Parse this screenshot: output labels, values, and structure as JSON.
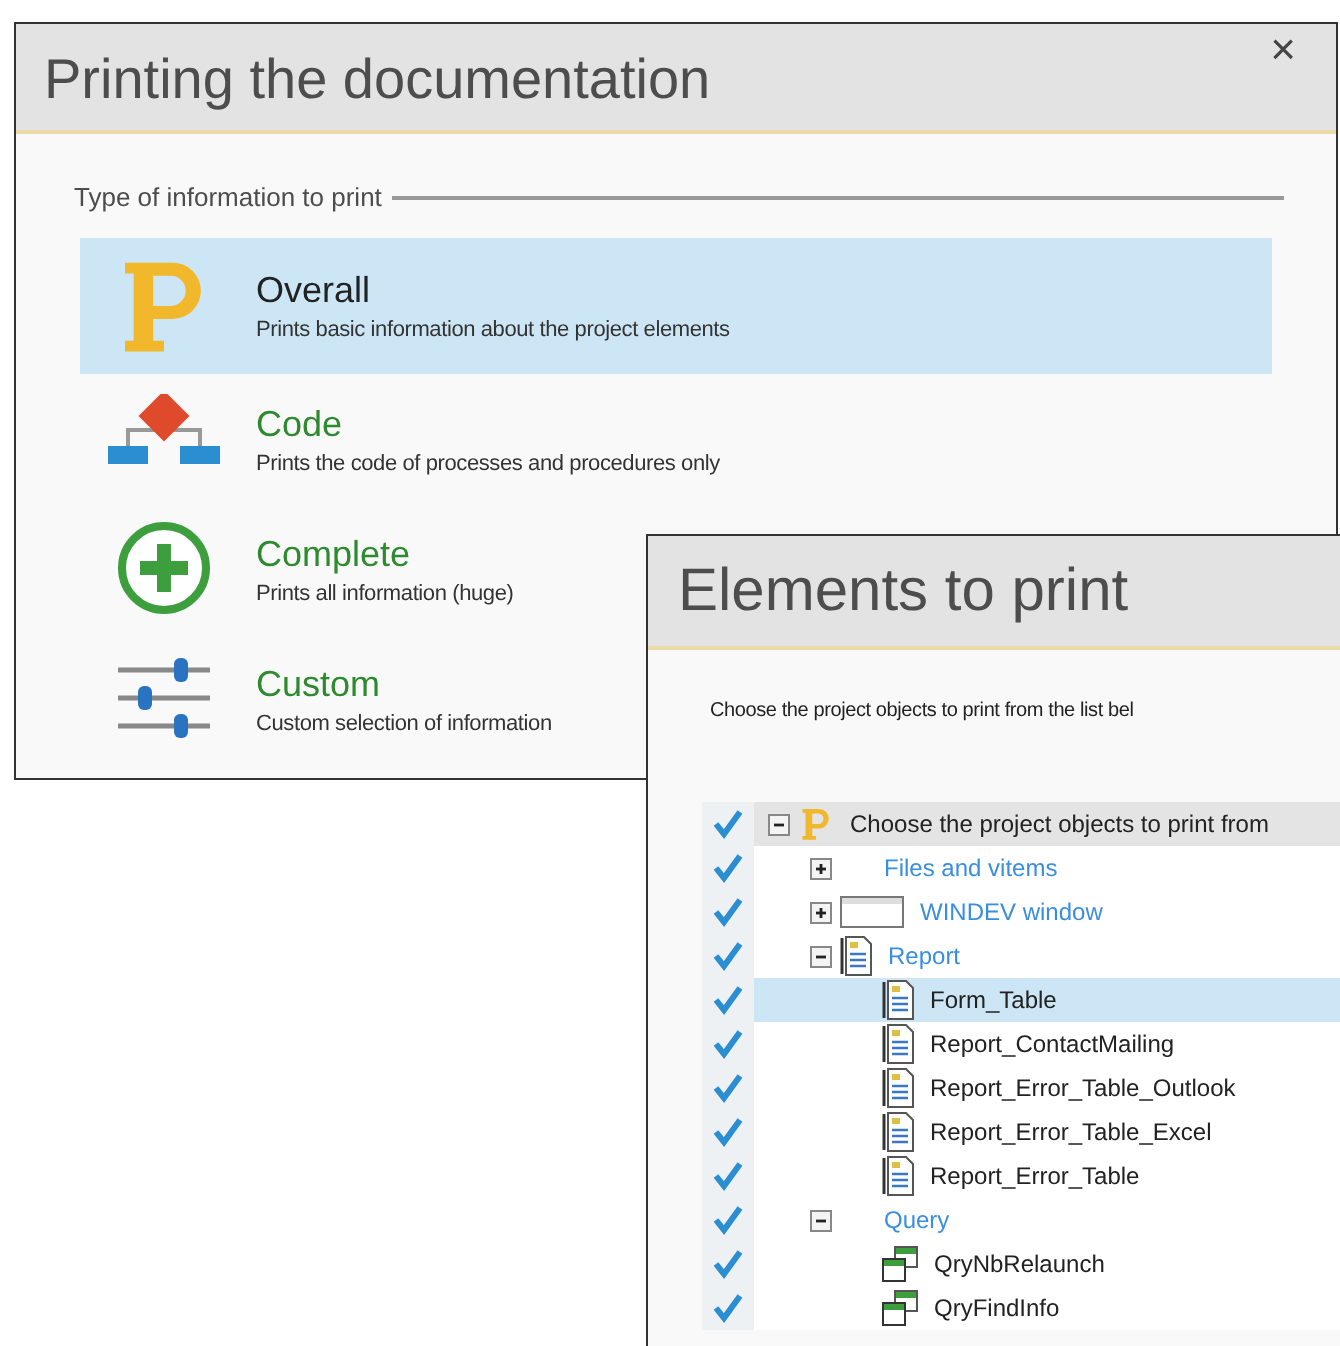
{
  "print_dialog": {
    "title": "Printing the documentation",
    "close": "×",
    "group_label": "Type of information to print",
    "options": [
      {
        "kind": "overall",
        "title": "Overall",
        "description": "Prints basic information about the project elements",
        "selected": true
      },
      {
        "kind": "code",
        "title": "Code",
        "description": "Prints the code of processes and procedures only",
        "selected": false
      },
      {
        "kind": "complete",
        "title": "Complete",
        "description": "Prints all information (huge)",
        "selected": false
      },
      {
        "kind": "custom",
        "title": "Custom",
        "description": "Custom selection of information",
        "selected": false
      }
    ]
  },
  "elements_dialog": {
    "title": "Elements to print",
    "instruction": "Choose the project objects to print from the list bel",
    "tree": [
      {
        "label": "Choose the project objects to print from",
        "kind": "project",
        "checked": true,
        "expanded": true,
        "selected": false,
        "children": [
          {
            "label": "Files and vitems",
            "kind": "none",
            "checked": true,
            "expanded": false,
            "selected": false
          },
          {
            "label": "WINDEV window",
            "kind": "window",
            "checked": true,
            "expanded": false,
            "selected": false
          },
          {
            "label": "Report",
            "kind": "report",
            "checked": true,
            "expanded": true,
            "selected": false,
            "children": [
              {
                "label": "Form_Table",
                "kind": "report",
                "checked": true,
                "selected": true
              },
              {
                "label": "Report_ContactMailing",
                "kind": "report",
                "checked": true,
                "selected": false
              },
              {
                "label": "Report_Error_Table_Outlook",
                "kind": "report",
                "checked": true,
                "selected": false
              },
              {
                "label": "Report_Error_Table_Excel",
                "kind": "report",
                "checked": true,
                "selected": false
              },
              {
                "label": "Report_Error_Table",
                "kind": "report",
                "checked": true,
                "selected": false
              }
            ]
          },
          {
            "label": "Query",
            "kind": "none",
            "checked": true,
            "expanded": true,
            "selected": false,
            "children": [
              {
                "label": "QryNbRelaunch",
                "kind": "query",
                "checked": true,
                "selected": false
              },
              {
                "label": "QryFindInfo",
                "kind": "query",
                "checked": true,
                "selected": false
              }
            ]
          }
        ]
      }
    ]
  }
}
